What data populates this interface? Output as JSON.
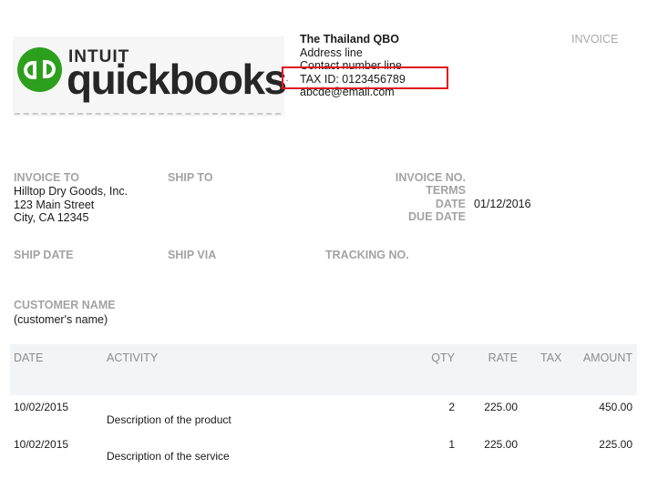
{
  "logo": {
    "brand_top": "INTUIT",
    "brand_main": "quickbooks",
    "mark": "qb-logo-icon"
  },
  "company": {
    "name": "The Thailand QBO",
    "address": "Address line",
    "contact": "Contact number line",
    "tax_id": "TAX ID: 0123456789",
    "email": "abcde@email.com"
  },
  "document_title": "INVOICE",
  "invoice_to": {
    "label": "INVOICE TO",
    "lines": [
      "Hilltop Dry Goods, Inc.",
      "123 Main Street",
      "City, CA 12345"
    ]
  },
  "ship_to": {
    "label": "SHIP TO"
  },
  "meta": {
    "invoice_no_label": "INVOICE NO.",
    "terms_label": "TERMS",
    "date_label": "DATE",
    "date_value": "01/12/2016",
    "due_date_label": "DUE DATE"
  },
  "shipping": {
    "ship_date_label": "SHIP DATE",
    "ship_via_label": "SHIP VIA",
    "tracking_label": "TRACKING NO."
  },
  "customer": {
    "label": "CUSTOMER NAME",
    "value": "(customer's name)"
  },
  "table": {
    "headers": {
      "date": "DATE",
      "activity": "ACTIVITY",
      "qty": "QTY",
      "rate": "RATE",
      "tax": "TAX",
      "amount": "AMOUNT"
    },
    "rows": [
      {
        "date": "10/02/2015",
        "activity": "Description of the product",
        "qty": "2",
        "rate": "225.00",
        "amount": "450.00"
      },
      {
        "date": "10/02/2015",
        "activity": "Description of the service",
        "qty": "1",
        "rate": "225.00",
        "amount": "225.00"
      }
    ]
  },
  "colors": {
    "brand_green": "#2ca01c",
    "highlight_red": "#e0161b",
    "label_gray": "#a3a3a3"
  }
}
